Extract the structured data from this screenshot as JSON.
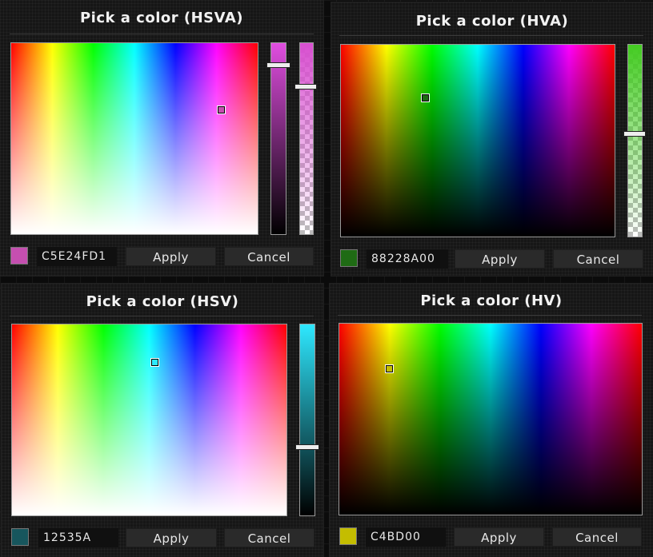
{
  "pickers": [
    {
      "title": "Pick a color (HSVA)",
      "hex": "C5E24FD1",
      "swatch_color": "#c54fb0",
      "apply_label": "Apply",
      "cancel_label": "Cancel",
      "marker": {
        "saturation": 0.86,
        "value": 0.35
      },
      "value_level": 0.88,
      "alpha_level": 0.78,
      "value_slider_color": "#e04ee0",
      "alpha_slider_color": "#d84fd0"
    },
    {
      "title": "Pick a color (HVA)",
      "hex": "88228A00",
      "swatch_color": "#1f6b14",
      "apply_label": "Apply",
      "cancel_label": "Cancel",
      "marker": {
        "hue_fraction": 0.31,
        "value": 0.73
      },
      "alpha_level": 0.53,
      "alpha_slider_color": "#44cc22"
    },
    {
      "title": "Pick a color (HSV)",
      "hex": "12535A",
      "swatch_color": "#17565d",
      "apply_label": "Apply",
      "cancel_label": "Cancel",
      "marker": {
        "hue_fraction": 0.52,
        "saturation": 0.79
      },
      "value_level": 0.35,
      "value_slider_color": "#2ee8ff"
    },
    {
      "title": "Pick a color (HV)",
      "hex": "C4BD00",
      "swatch_color": "#c4bd00",
      "apply_label": "Apply",
      "cancel_label": "Cancel",
      "marker": {
        "hue_fraction": 0.16,
        "value": 0.77
      }
    }
  ]
}
